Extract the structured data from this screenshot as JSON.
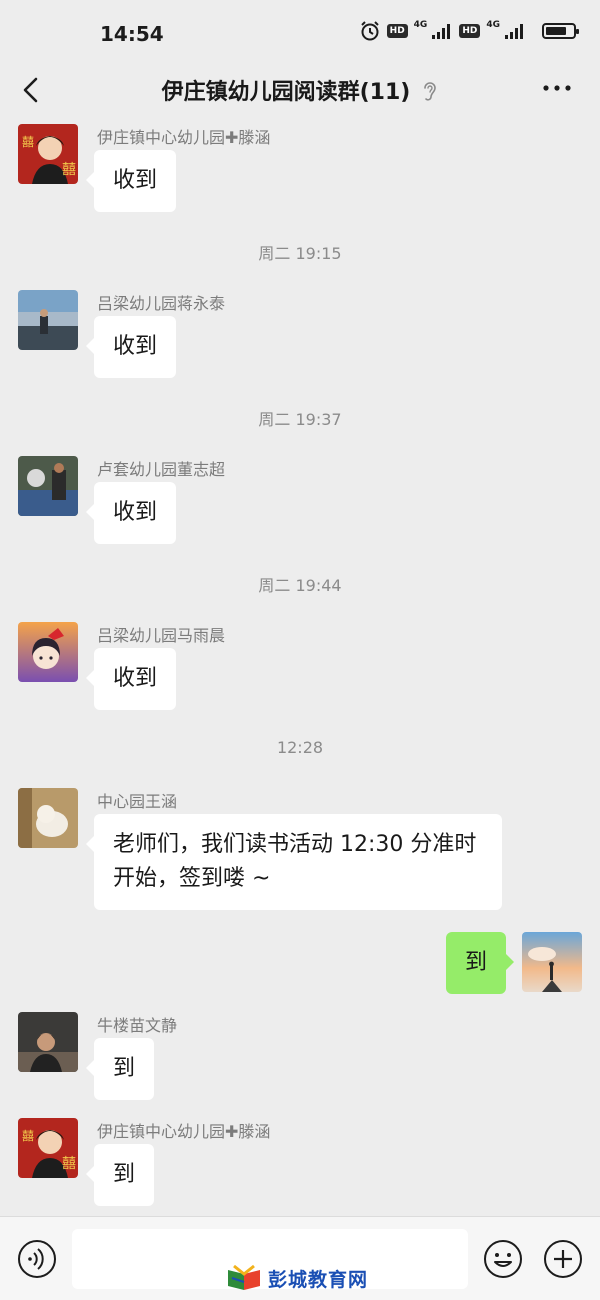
{
  "status": {
    "time": "14:54",
    "net1": "4G",
    "net2": "4G",
    "hd1": "HD",
    "hd2": "HD",
    "battery_level": 0.78
  },
  "header": {
    "title": "伊庄镇幼儿园阅读群(11)",
    "back_icon": "chevron-left-icon",
    "ear_icon": "ear-icon",
    "more_icon": "more-dots-icon"
  },
  "messages": [
    {
      "sender": "伊庄镇中心幼儿园✚滕涵",
      "text": "收到"
    },
    {
      "time": "周二 19:15"
    },
    {
      "sender": "吕梁幼儿园蒋永泰",
      "text": "收到"
    },
    {
      "time": "周二 19:37"
    },
    {
      "sender": "卢套幼儿园董志超",
      "text": "收到"
    },
    {
      "time": "周二 19:44"
    },
    {
      "sender": "吕梁幼儿园马雨晨",
      "text": "收到"
    },
    {
      "time": "12:28"
    },
    {
      "sender": "中心园王涵",
      "text": "老师们，我们读书活动 12:30 分准时开始，签到喽 ~"
    },
    {
      "self": true,
      "text": "到"
    },
    {
      "sender": "牛楼苗文静",
      "text": "到"
    },
    {
      "sender": "伊庄镇中心幼儿园✚滕涵",
      "text": "到"
    }
  ],
  "input": {
    "value": "",
    "voice_icon": "voice-icon",
    "emoji_icon": "emoji-icon",
    "plus_icon": "plus-icon"
  },
  "watermark": {
    "text": "彭城教育网"
  },
  "colors": {
    "self_bubble": "#95ec69",
    "background": "#ededed"
  }
}
